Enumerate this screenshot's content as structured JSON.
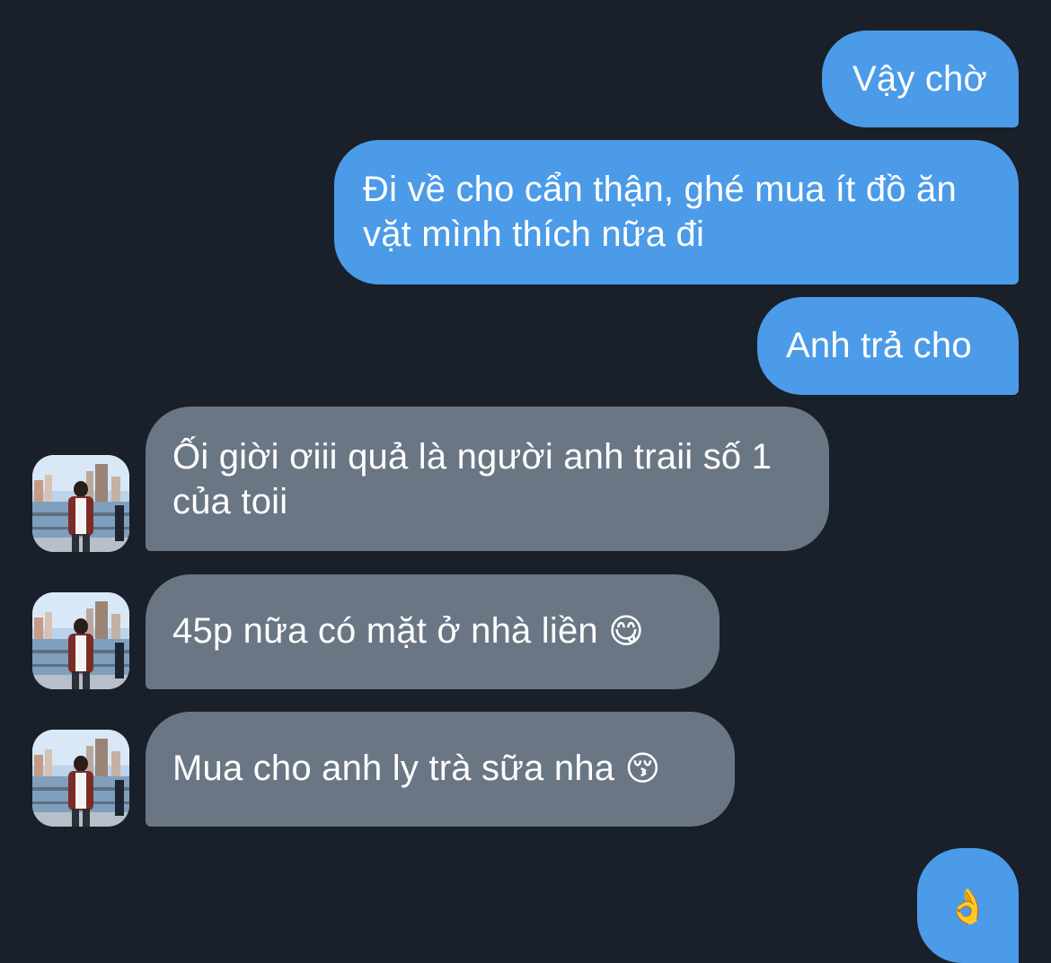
{
  "conversation": {
    "messages": [
      {
        "direction": "sent",
        "text": "Vậy chờ"
      },
      {
        "direction": "sent",
        "text": "Đi về cho cẩn thận, ghé mua ít đồ ăn vặt mình thích nữa đi"
      },
      {
        "direction": "sent",
        "text": "Anh trả cho"
      },
      {
        "direction": "received",
        "text": " Ối giời ơiii quả là người anh traii số 1 của toii"
      },
      {
        "direction": "received",
        "text": "45p nữa có mặt ở nhà liền",
        "emoji": "😋"
      },
      {
        "direction": "received",
        "text": "Mua cho anh ly trà sữa nha",
        "emoji": "😚"
      },
      {
        "direction": "sent",
        "text": "",
        "emoji": "👌"
      }
    ]
  },
  "colors": {
    "background": "#19202a",
    "sent_bubble": "#4b9be8",
    "received_bubble": "#6a7684",
    "text": "#ffffff"
  }
}
